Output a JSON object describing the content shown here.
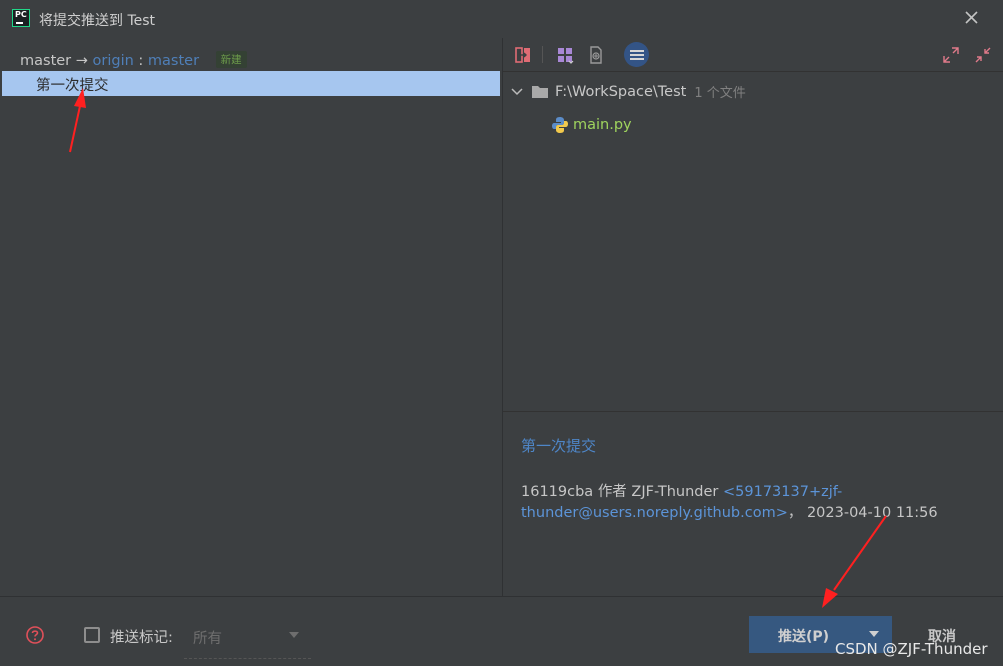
{
  "window": {
    "title": "将提交推送到 Test",
    "app_icon_text": "PC"
  },
  "left": {
    "local_branch": "master",
    "arrow": "→",
    "remote": "origin",
    "colon": ":",
    "remote_branch": "master",
    "new_badge": "新建",
    "commits": [
      {
        "message": "第一次提交"
      }
    ]
  },
  "toolbar": {
    "icons": [
      "compare-icon",
      "group-by-icon",
      "expand-patch-icon",
      "list-view-icon",
      "expand-all-icon",
      "collapse-all-icon"
    ]
  },
  "tree": {
    "folder_path": "F:\\WorkSpace\\Test",
    "folder_count": "1 个文件",
    "files": [
      {
        "name": "main.py"
      }
    ]
  },
  "details": {
    "subject": "第一次提交",
    "hash": "16119cba",
    "author_prefix": "作者",
    "author": "ZJF-Thunder",
    "email": "<59173137+zjf-thunder@users.noreply.github.com>",
    "date_sep": "，",
    "date": "2023-04-10 11:56"
  },
  "bottom": {
    "push_tags_label": "推送标记:",
    "push_tags_value": "所有",
    "push_button": "推送(P)",
    "cancel_button": "取消"
  },
  "watermark": "CSDN @ZJF-Thunder",
  "colors": {
    "background": "#3c3f41",
    "selection": "#a6c6ef",
    "accent_blue": "#4f7fb8",
    "file_green": "#9fd45e",
    "push_button": "#365880"
  }
}
